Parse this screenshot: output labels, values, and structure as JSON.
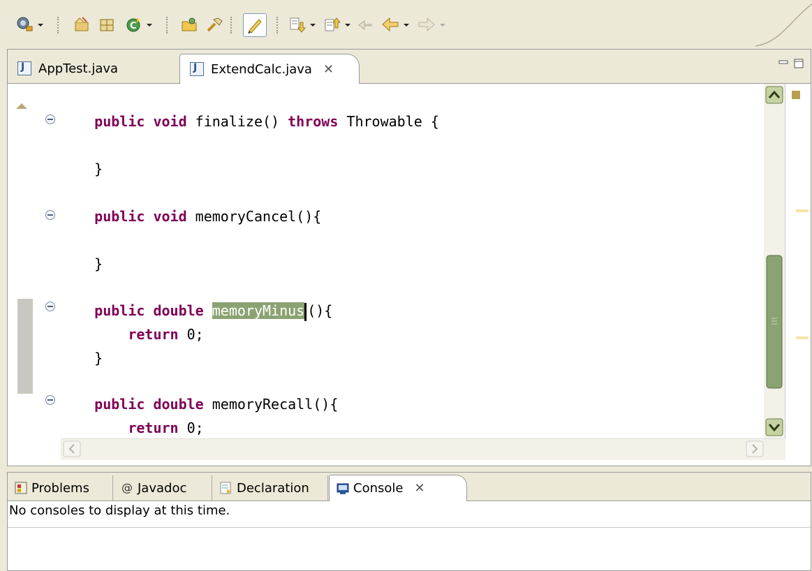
{
  "editor": {
    "tabs": [
      {
        "label": "AppTest.java",
        "active": false
      },
      {
        "label": "ExtendCalc.java",
        "active": true
      }
    ],
    "close_glyph": "✕",
    "code_lines": {
      "l1": {
        "kw": "public void",
        "rest": " finalize() ",
        "kw2": "throws",
        "rest2": " Throwable {"
      },
      "l2": "}",
      "l3": {
        "kw": "public void",
        "rest": " memoryCancel(){"
      },
      "l4": "}",
      "l5": {
        "kw": "public double",
        "sel": "memoryMinus",
        "rest": "(){"
      },
      "l6": {
        "kw": "return",
        "rest": " 0;"
      },
      "l7": "}",
      "l8": {
        "kw": "public double",
        "rest": " memoryRecall(){"
      },
      "l9": {
        "kw": "return",
        "rest": " 0;"
      }
    }
  },
  "views": {
    "tabs": [
      {
        "label": "Problems"
      },
      {
        "label": "Javadoc"
      },
      {
        "label": "Declaration"
      },
      {
        "label": "Console",
        "active": true
      }
    ],
    "console_message": "No consoles to display at this time."
  },
  "colors": {
    "keyword": "#7f0055",
    "selection": "#8ba372",
    "current_line": "#e8f2fe",
    "chrome": "#ece9d8"
  },
  "icons": {
    "toolbar": [
      "new-wizard-icon",
      "new-java-project-icon",
      "new-package-icon",
      "new-class-icon",
      "open-type-icon",
      "search-icon",
      "toggle-mark-occurrences-icon",
      "next-annotation-icon",
      "previous-annotation-icon",
      "last-edit-location-icon",
      "back-icon",
      "forward-icon"
    ]
  }
}
